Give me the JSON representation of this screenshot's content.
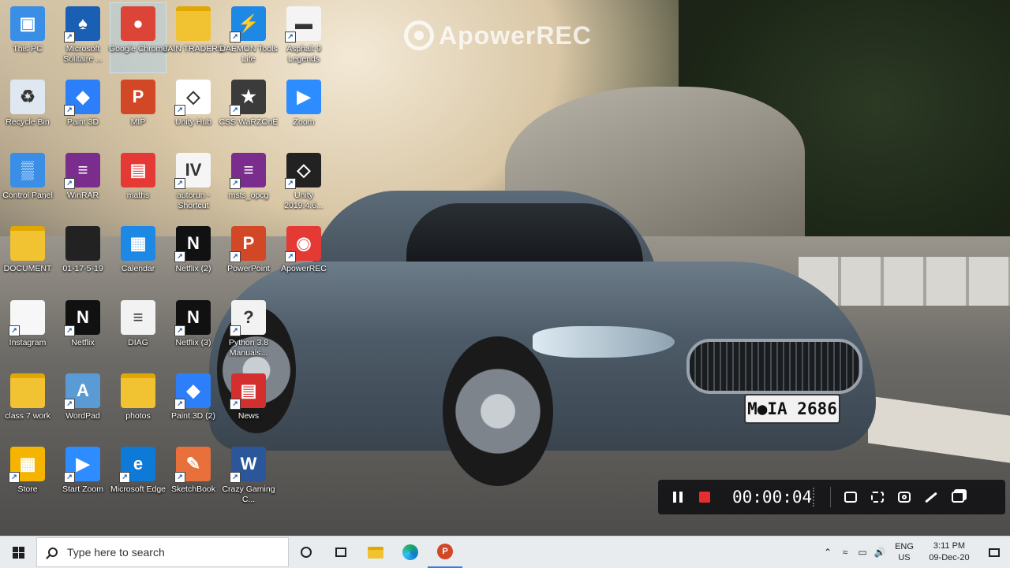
{
  "watermark": {
    "text": "ApowerREC"
  },
  "car": {
    "plate": "M●IA 2686"
  },
  "desktop_icons": [
    {
      "label": "This PC",
      "icon": "computer-icon",
      "color": "#3a8ee6",
      "glyph": "▣",
      "shortcut": false,
      "selected": false
    },
    {
      "label": "Microsoft Solitaire ...",
      "icon": "cards-icon",
      "color": "#1a5fb4",
      "glyph": "♠",
      "shortcut": true,
      "selected": false
    },
    {
      "label": "Google Chrome",
      "icon": "chrome-icon",
      "color": "#db4437",
      "glyph": "●",
      "shortcut": false,
      "selected": true
    },
    {
      "label": "JAIN TRADERS",
      "icon": "folder-icon",
      "color": "#f1c232",
      "glyph": "",
      "shortcut": false,
      "selected": false
    },
    {
      "label": "DAEMON Tools Lite",
      "icon": "daemon-tools-icon",
      "color": "#1e88e5",
      "glyph": "⚡",
      "shortcut": true,
      "selected": false
    },
    {
      "label": "Asphalt 9 Legends",
      "icon": "asphalt-icon",
      "color": "#f4f4f4",
      "glyph": "▬",
      "shortcut": true,
      "selected": false
    },
    {
      "label": "Recycle Bin",
      "icon": "recycle-bin-icon",
      "color": "#dfe8f0",
      "glyph": "♻",
      "shortcut": false,
      "selected": false
    },
    {
      "label": "Paint 3D",
      "icon": "paint3d-icon",
      "color": "#2d7ff9",
      "glyph": "◆",
      "shortcut": true,
      "selected": false
    },
    {
      "label": "MIP",
      "icon": "powerpoint-file-icon",
      "color": "#d24726",
      "glyph": "P",
      "shortcut": false,
      "selected": false
    },
    {
      "label": "Unity Hub",
      "icon": "unity-hub-icon",
      "color": "#ffffff",
      "glyph": "◇",
      "shortcut": true,
      "selected": false
    },
    {
      "label": "CSS WaRZOnE",
      "icon": "css-icon",
      "color": "#3b3b3b",
      "glyph": "★",
      "shortcut": true,
      "selected": false
    },
    {
      "label": "Zoom",
      "icon": "zoom-icon",
      "color": "#2d8cff",
      "glyph": "▶",
      "shortcut": false,
      "selected": false
    },
    {
      "label": "Control Panel",
      "icon": "control-panel-icon",
      "color": "#3a8ee6",
      "glyph": "▒",
      "shortcut": false,
      "selected": false
    },
    {
      "label": "WinRAR",
      "icon": "winrar-icon",
      "color": "#7b2d8e",
      "glyph": "≡",
      "shortcut": true,
      "selected": false
    },
    {
      "label": "maths",
      "icon": "pdf-folder-icon",
      "color": "#e53935",
      "glyph": "▤",
      "shortcut": false,
      "selected": false
    },
    {
      "label": "autorun - Shortcut",
      "icon": "gta-iv-icon",
      "color": "#f5f5f5",
      "glyph": "IV",
      "shortcut": true,
      "selected": false
    },
    {
      "label": "msts_opcg",
      "icon": "winrar-archive-icon",
      "color": "#7b2d8e",
      "glyph": "≡",
      "shortcut": true,
      "selected": false
    },
    {
      "label": "Unity 2019.4.6...",
      "icon": "unity-icon",
      "color": "#222222",
      "glyph": "◇",
      "shortcut": true,
      "selected": false
    },
    {
      "label": "DOCUMENT",
      "icon": "folder-icon",
      "color": "#f1c232",
      "glyph": "",
      "shortcut": false,
      "selected": false
    },
    {
      "label": "01-17-5-19",
      "icon": "folder-icon",
      "color": "#222222",
      "glyph": "",
      "shortcut": false,
      "selected": false
    },
    {
      "label": "Calendar",
      "icon": "calendar-icon",
      "color": "#1e88e5",
      "glyph": "▦",
      "shortcut": false,
      "selected": false
    },
    {
      "label": "Netflix (2)",
      "icon": "netflix-icon",
      "color": "#111111",
      "glyph": "N",
      "shortcut": true,
      "selected": false
    },
    {
      "label": "PowerPoint",
      "icon": "powerpoint-icon",
      "color": "#d24726",
      "glyph": "P",
      "shortcut": true,
      "selected": false
    },
    {
      "label": "ApowerREC",
      "icon": "apowerrec-icon",
      "color": "#e53935",
      "glyph": "◉",
      "shortcut": true,
      "selected": false
    },
    {
      "label": "Instagram",
      "icon": "file-icon",
      "color": "#f7f7f7",
      "glyph": "",
      "shortcut": true,
      "selected": false
    },
    {
      "label": "Netflix",
      "icon": "netflix-icon",
      "color": "#111111",
      "glyph": "N",
      "shortcut": true,
      "selected": false
    },
    {
      "label": "DIAG",
      "icon": "text-file-icon",
      "color": "#f2f2f2",
      "glyph": "≡",
      "shortcut": false,
      "selected": false
    },
    {
      "label": "Netflix (3)",
      "icon": "netflix-icon",
      "color": "#111111",
      "glyph": "N",
      "shortcut": true,
      "selected": false
    },
    {
      "label": "Python 3.8 Manuals...",
      "icon": "python-help-icon",
      "color": "#f2f2f2",
      "glyph": "?",
      "shortcut": true,
      "selected": false
    },
    {
      "label": "class 7 work",
      "icon": "folder-icon",
      "color": "#f1c232",
      "glyph": "",
      "shortcut": false,
      "selected": false
    },
    {
      "label": "WordPad",
      "icon": "wordpad-icon",
      "color": "#5b9bd5",
      "glyph": "A",
      "shortcut": true,
      "selected": false
    },
    {
      "label": "photos",
      "icon": "folder-icon",
      "color": "#f1c232",
      "glyph": "",
      "shortcut": false,
      "selected": false
    },
    {
      "label": "Paint 3D (2)",
      "icon": "paint3d-icon",
      "color": "#2d7ff9",
      "glyph": "◆",
      "shortcut": true,
      "selected": false
    },
    {
      "label": "News",
      "icon": "news-icon",
      "color": "#d32f2f",
      "glyph": "▤",
      "shortcut": true,
      "selected": false
    },
    {
      "label": "Store",
      "icon": "store-icon",
      "color": "#f5b400",
      "glyph": "▦",
      "shortcut": true,
      "selected": false
    },
    {
      "label": "Start Zoom",
      "icon": "zoom-icon",
      "color": "#2d8cff",
      "glyph": "▶",
      "shortcut": true,
      "selected": false
    },
    {
      "label": "Microsoft Edge",
      "icon": "edge-icon",
      "color": "#0c7ad6",
      "glyph": "e",
      "shortcut": true,
      "selected": false
    },
    {
      "label": "SketchBook",
      "icon": "sketchbook-icon",
      "color": "#e8703a",
      "glyph": "✎",
      "shortcut": true,
      "selected": false
    },
    {
      "label": "Crazy Gaming C...",
      "icon": "word-doc-icon",
      "color": "#2b579a",
      "glyph": "W",
      "shortcut": true,
      "selected": false
    }
  ],
  "recorder": {
    "timer": "00:00:04",
    "pause_icon": "pause-icon",
    "stop_icon": "stop-icon",
    "stop_color": "#e62e2e",
    "tools": [
      "screenshot-region-icon",
      "fullscreen-icon",
      "camera-icon",
      "pen-icon",
      "restore-window-icon"
    ]
  },
  "taskbar": {
    "search_placeholder": "Type here to search",
    "pinned": [
      "cortana-icon",
      "task-view-icon",
      "file-explorer-icon",
      "edge-icon",
      "powerpoint-icon"
    ],
    "tray": {
      "lang_line1": "ENG",
      "lang_line2": "US",
      "time": "3:11 PM",
      "date": "09-Dec-20"
    }
  }
}
